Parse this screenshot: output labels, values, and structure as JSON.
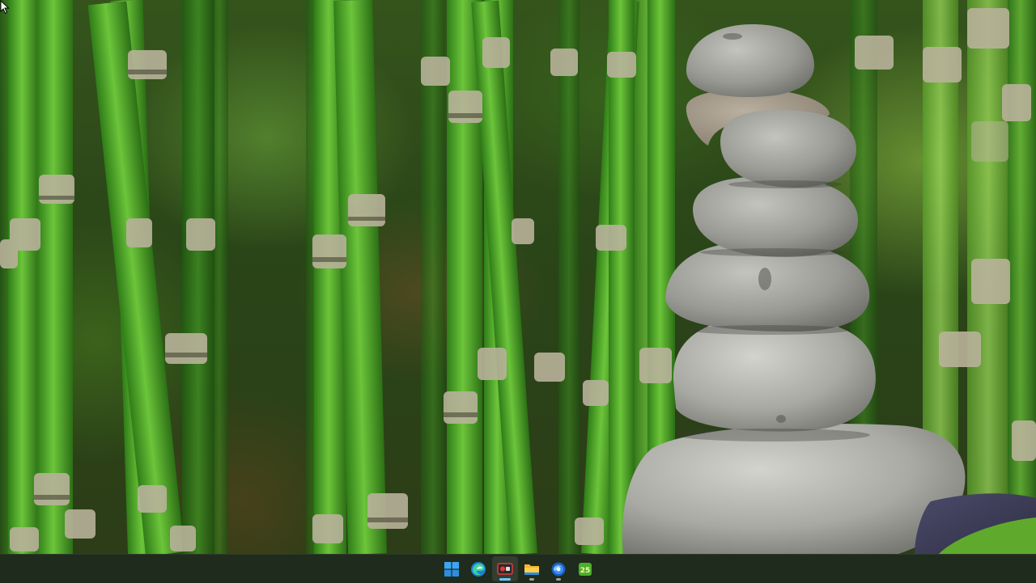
{
  "wallpaper": {
    "subject": "zen-stone-stack-bamboo",
    "dominant_colors": [
      "#3f8f22",
      "#7fcf3b",
      "#9c9c98",
      "#2a4518"
    ]
  },
  "taskbar": {
    "background": "#1f2b1c",
    "apps": [
      {
        "name": "start",
        "icon": "windows-start-icon",
        "active": false
      },
      {
        "name": "edge",
        "icon": "edge-browser-icon",
        "active": false
      },
      {
        "name": "recorder",
        "icon": "screen-recorder-icon",
        "active": true
      },
      {
        "name": "explorer",
        "icon": "file-explorer-folder-icon",
        "active": false
      },
      {
        "name": "browser",
        "icon": "blue-globe-browser-icon",
        "active": false
      },
      {
        "name": "app-25",
        "icon": "green-app-25-icon",
        "active": false,
        "badge_text": "25"
      }
    ]
  }
}
